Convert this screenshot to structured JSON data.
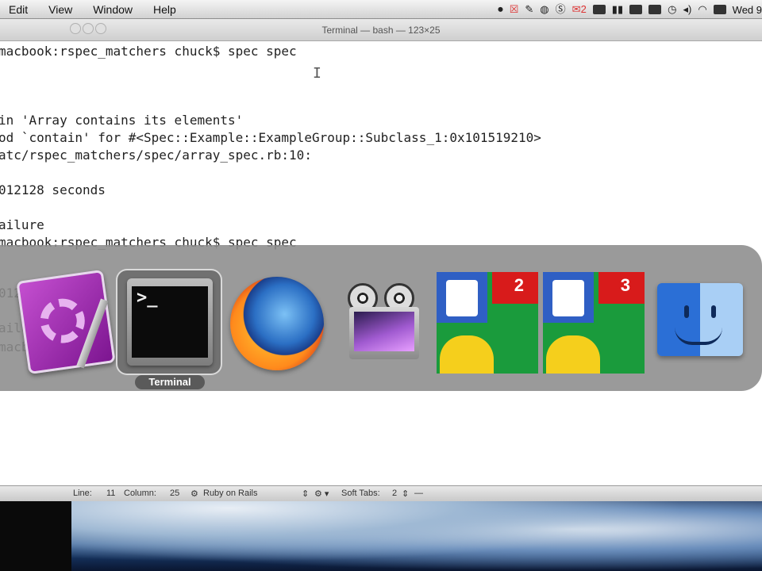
{
  "menubar": {
    "items": [
      "Edit",
      "View",
      "Window",
      "Help"
    ],
    "mail_count": "2",
    "clock": "Wed 9",
    "icons": [
      "record-icon",
      "close-box-icon",
      "pin-icon",
      "status-circle-icon",
      "skype-icon",
      "gmail-icon",
      "display-icon",
      "signal-bars-icon",
      "battery-icon",
      "bag-icon",
      "clock-icon",
      "volume-icon",
      "wifi-icon",
      "keyboard-icon"
    ]
  },
  "terminal": {
    "title": "Terminal — bash — 123×25",
    "lines": [
      "macbook:rspec_matchers chuck$ spec spec",
      "in 'Array contains its elements'",
      "od `contain' for #<Spec::Example::ExampleGroup::Subclass_1:0x101519210>",
      "atc/rspec_matchers/spec/array_spec.rb:10:",
      "012128 seconds",
      "ailure",
      "macbook:rspec_matchers chuck$ spec spec",
      "012",
      "ailu",
      "macbo"
    ]
  },
  "switcher": {
    "selected_label": "Terminal",
    "apps": [
      {
        "name": "textmate-editor-icon"
      },
      {
        "name": "terminal-icon",
        "prompt": ">_"
      },
      {
        "name": "firefox-icon"
      },
      {
        "name": "screenflow-icon"
      },
      {
        "name": "google-notifier-icon",
        "badge": "2"
      },
      {
        "name": "google-notifier-icon",
        "badge": "3"
      },
      {
        "name": "finder-icon"
      }
    ]
  },
  "statusbar": {
    "line_label": "Line:",
    "line_value": "11",
    "column_label": "Column:",
    "column_value": "25",
    "language": "Ruby on Rails",
    "tabs_label": "Soft Tabs:",
    "tabs_value": "2"
  }
}
